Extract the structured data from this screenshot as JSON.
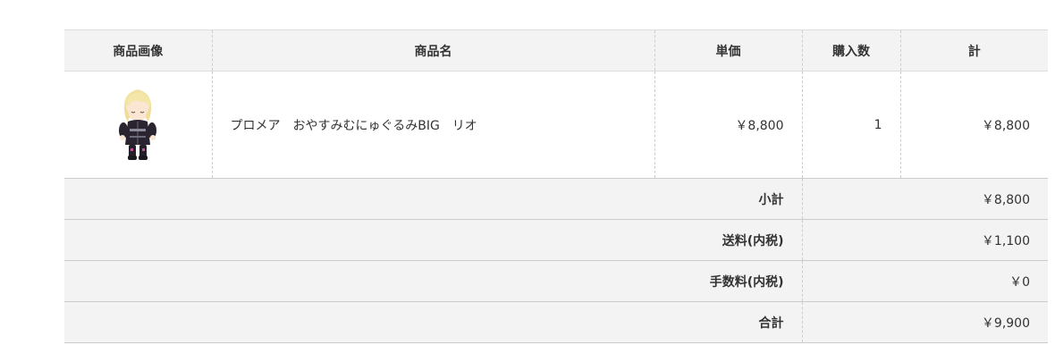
{
  "cart": {
    "headers": {
      "image": "商品画像",
      "name": "商品名",
      "unit_price": "単価",
      "quantity": "購入数",
      "total": "計"
    },
    "items": [
      {
        "name": "プロメア　おやすみむにゅぐるみBIG　リオ",
        "unit_price": "￥8,800",
        "quantity": "1",
        "total": "￥8,800"
      }
    ],
    "summary": {
      "subtotal_label": "小計",
      "subtotal_value": "￥8,800",
      "shipping_label": "送料(内税)",
      "shipping_value": "￥1,100",
      "fee_label": "手数料(内税)",
      "fee_value": "￥0",
      "grand_total_label": "合計",
      "grand_total_value": "￥9,900"
    }
  }
}
